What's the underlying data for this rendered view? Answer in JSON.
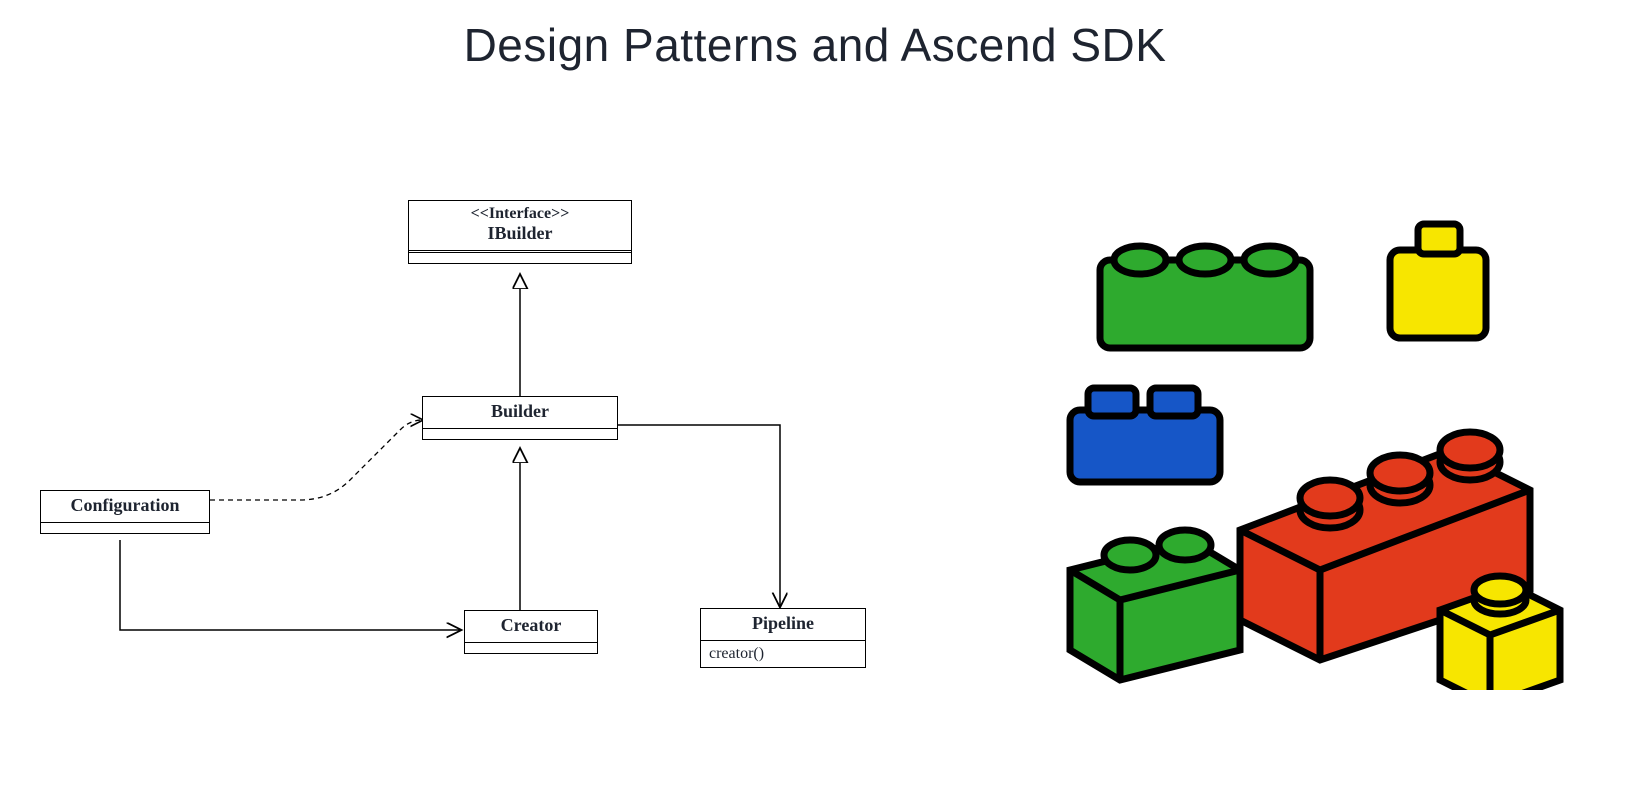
{
  "title": "Design Patterns and Ascend SDK",
  "uml": {
    "ibuilder": {
      "stereotype": "<<Interface>>",
      "name": "IBuilder"
    },
    "builder": {
      "name": "Builder"
    },
    "configuration": {
      "name": "Configuration"
    },
    "creator": {
      "name": "Creator"
    },
    "pipeline": {
      "name": "Pipeline",
      "op": "creator()"
    }
  },
  "lego": {
    "bricks": [
      {
        "color": "green",
        "studs": 3
      },
      {
        "color": "yellow",
        "studs": 1
      },
      {
        "color": "blue",
        "studs": 2
      },
      {
        "color": "red",
        "studs": 3
      },
      {
        "color": "green",
        "studs": 2
      },
      {
        "color": "yellow",
        "studs": 1
      }
    ]
  }
}
